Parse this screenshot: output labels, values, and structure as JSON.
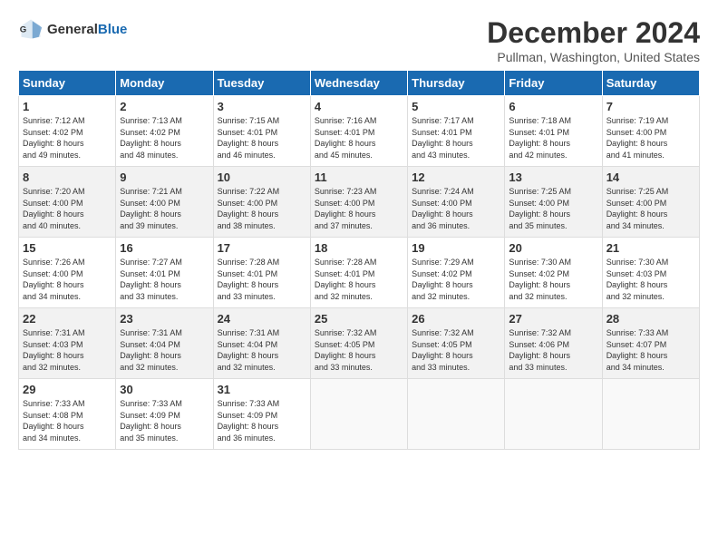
{
  "logo": {
    "general": "General",
    "blue": "Blue"
  },
  "title": "December 2024",
  "subtitle": "Pullman, Washington, United States",
  "days": [
    "Sunday",
    "Monday",
    "Tuesday",
    "Wednesday",
    "Thursday",
    "Friday",
    "Saturday"
  ],
  "weeks": [
    [
      {
        "day": "1",
        "info": "Sunrise: 7:12 AM\nSunset: 4:02 PM\nDaylight: 8 hours\nand 49 minutes."
      },
      {
        "day": "2",
        "info": "Sunrise: 7:13 AM\nSunset: 4:02 PM\nDaylight: 8 hours\nand 48 minutes."
      },
      {
        "day": "3",
        "info": "Sunrise: 7:15 AM\nSunset: 4:01 PM\nDaylight: 8 hours\nand 46 minutes."
      },
      {
        "day": "4",
        "info": "Sunrise: 7:16 AM\nSunset: 4:01 PM\nDaylight: 8 hours\nand 45 minutes."
      },
      {
        "day": "5",
        "info": "Sunrise: 7:17 AM\nSunset: 4:01 PM\nDaylight: 8 hours\nand 43 minutes."
      },
      {
        "day": "6",
        "info": "Sunrise: 7:18 AM\nSunset: 4:01 PM\nDaylight: 8 hours\nand 42 minutes."
      },
      {
        "day": "7",
        "info": "Sunrise: 7:19 AM\nSunset: 4:00 PM\nDaylight: 8 hours\nand 41 minutes."
      }
    ],
    [
      {
        "day": "8",
        "info": "Sunrise: 7:20 AM\nSunset: 4:00 PM\nDaylight: 8 hours\nand 40 minutes."
      },
      {
        "day": "9",
        "info": "Sunrise: 7:21 AM\nSunset: 4:00 PM\nDaylight: 8 hours\nand 39 minutes."
      },
      {
        "day": "10",
        "info": "Sunrise: 7:22 AM\nSunset: 4:00 PM\nDaylight: 8 hours\nand 38 minutes."
      },
      {
        "day": "11",
        "info": "Sunrise: 7:23 AM\nSunset: 4:00 PM\nDaylight: 8 hours\nand 37 minutes."
      },
      {
        "day": "12",
        "info": "Sunrise: 7:24 AM\nSunset: 4:00 PM\nDaylight: 8 hours\nand 36 minutes."
      },
      {
        "day": "13",
        "info": "Sunrise: 7:25 AM\nSunset: 4:00 PM\nDaylight: 8 hours\nand 35 minutes."
      },
      {
        "day": "14",
        "info": "Sunrise: 7:25 AM\nSunset: 4:00 PM\nDaylight: 8 hours\nand 34 minutes."
      }
    ],
    [
      {
        "day": "15",
        "info": "Sunrise: 7:26 AM\nSunset: 4:00 PM\nDaylight: 8 hours\nand 34 minutes."
      },
      {
        "day": "16",
        "info": "Sunrise: 7:27 AM\nSunset: 4:01 PM\nDaylight: 8 hours\nand 33 minutes."
      },
      {
        "day": "17",
        "info": "Sunrise: 7:28 AM\nSunset: 4:01 PM\nDaylight: 8 hours\nand 33 minutes."
      },
      {
        "day": "18",
        "info": "Sunrise: 7:28 AM\nSunset: 4:01 PM\nDaylight: 8 hours\nand 32 minutes."
      },
      {
        "day": "19",
        "info": "Sunrise: 7:29 AM\nSunset: 4:02 PM\nDaylight: 8 hours\nand 32 minutes."
      },
      {
        "day": "20",
        "info": "Sunrise: 7:30 AM\nSunset: 4:02 PM\nDaylight: 8 hours\nand 32 minutes."
      },
      {
        "day": "21",
        "info": "Sunrise: 7:30 AM\nSunset: 4:03 PM\nDaylight: 8 hours\nand 32 minutes."
      }
    ],
    [
      {
        "day": "22",
        "info": "Sunrise: 7:31 AM\nSunset: 4:03 PM\nDaylight: 8 hours\nand 32 minutes."
      },
      {
        "day": "23",
        "info": "Sunrise: 7:31 AM\nSunset: 4:04 PM\nDaylight: 8 hours\nand 32 minutes."
      },
      {
        "day": "24",
        "info": "Sunrise: 7:31 AM\nSunset: 4:04 PM\nDaylight: 8 hours\nand 32 minutes."
      },
      {
        "day": "25",
        "info": "Sunrise: 7:32 AM\nSunset: 4:05 PM\nDaylight: 8 hours\nand 33 minutes."
      },
      {
        "day": "26",
        "info": "Sunrise: 7:32 AM\nSunset: 4:05 PM\nDaylight: 8 hours\nand 33 minutes."
      },
      {
        "day": "27",
        "info": "Sunrise: 7:32 AM\nSunset: 4:06 PM\nDaylight: 8 hours\nand 33 minutes."
      },
      {
        "day": "28",
        "info": "Sunrise: 7:33 AM\nSunset: 4:07 PM\nDaylight: 8 hours\nand 34 minutes."
      }
    ],
    [
      {
        "day": "29",
        "info": "Sunrise: 7:33 AM\nSunset: 4:08 PM\nDaylight: 8 hours\nand 34 minutes."
      },
      {
        "day": "30",
        "info": "Sunrise: 7:33 AM\nSunset: 4:09 PM\nDaylight: 8 hours\nand 35 minutes."
      },
      {
        "day": "31",
        "info": "Sunrise: 7:33 AM\nSunset: 4:09 PM\nDaylight: 8 hours\nand 36 minutes."
      },
      null,
      null,
      null,
      null
    ]
  ]
}
